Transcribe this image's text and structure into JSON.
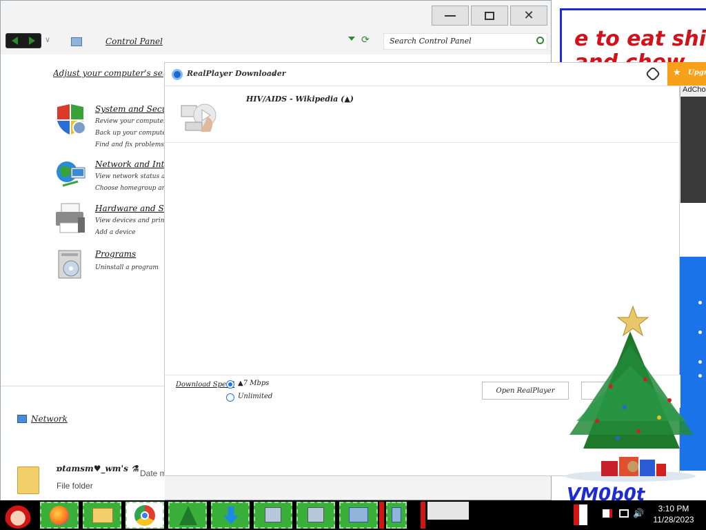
{
  "speech_bubble": {
    "text_line1": "e to eat shit",
    "text_line2": "and chew"
  },
  "wallpaper": {
    "signature": "VM0b0t"
  },
  "ad": {
    "adchoices_label": "AdChoi"
  },
  "control_panel": {
    "title": "Control Panel",
    "window_buttons": {
      "minimize": "—",
      "restore": "□",
      "close": "✕"
    },
    "address": "Control Panel",
    "search_placeholder": "Search Control Panel",
    "heading": "Adjust your computer's settings",
    "categories": [
      {
        "icon": "shield-icon",
        "title": "System and Security",
        "subs": [
          "Review your computer's status",
          "Back up your computer",
          "Find and fix problems"
        ]
      },
      {
        "icon": "globe-network-icon",
        "title": "Network and Internet",
        "subs": [
          "View network status and tasks",
          "Choose homegroup and sharing"
        ]
      },
      {
        "icon": "printer-icon",
        "title": "Hardware and Sound",
        "subs": [
          "View devices and printers",
          "Add a device"
        ]
      },
      {
        "icon": "programs-box-icon",
        "title": "Programs",
        "subs": [
          "Uninstall a program"
        ]
      }
    ]
  },
  "explorer": {
    "network_label": "Network",
    "item_name": "ɒtamsm♥_wm's ⚗",
    "date_column": "Date m",
    "item_type": "File folder"
  },
  "realplayer_downloader": {
    "title": "RealPlayer Downloader",
    "item_title": "HIV/AIDS - Wikipedia (▲)",
    "download_speed_label": "Download Speed",
    "speed_options": [
      {
        "label": "▲7 Mbps",
        "selected": true
      },
      {
        "label": "Unlimited",
        "selected": false
      }
    ],
    "open_button": "Open RealPlayer",
    "orange_tab_text": "Upgr"
  },
  "taskbar": {
    "apps": [
      "santa-start-icon",
      "firefox-icon",
      "file-explorer-icon",
      "chrome-icon",
      "christmas-tree-icon",
      "download-arrow-icon",
      "network-setup-icon",
      "network-setup-icon",
      "control-panel-icon",
      "control-panel-icon"
    ],
    "clock_time": "3:10 PM",
    "clock_date": "11/28/2023"
  }
}
